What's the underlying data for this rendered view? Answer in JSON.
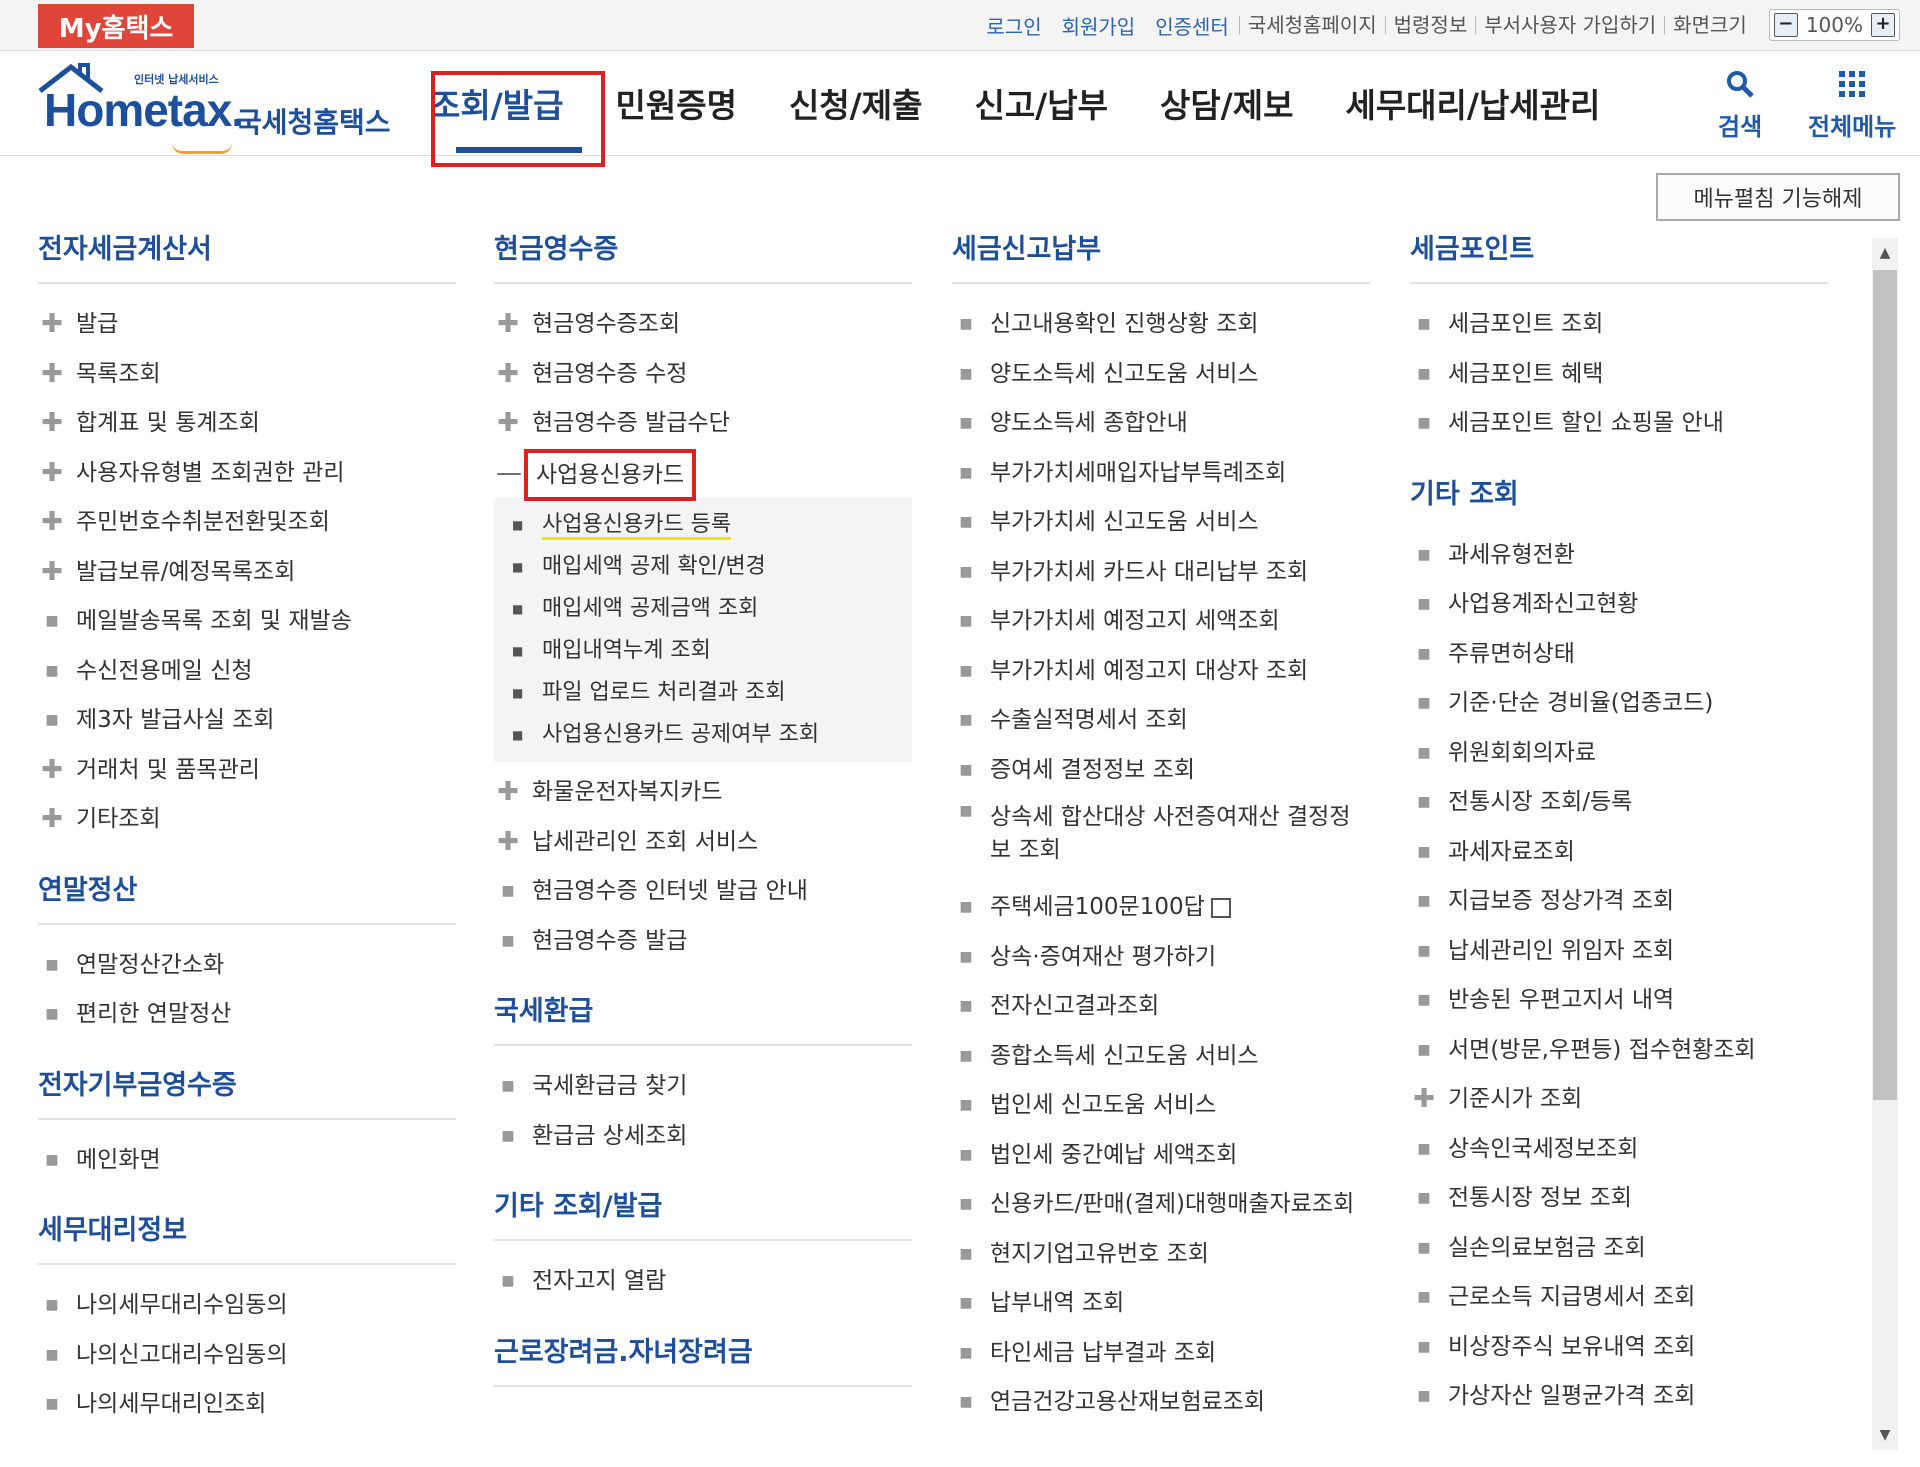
{
  "util_bar": {
    "my_tab": "My홈택스",
    "links_blue": [
      "로그인",
      "회원가입",
      "인증센터"
    ],
    "links_gray": [
      "국세청홈페이지",
      "법령정보",
      "부서사용자 가입하기",
      "화면크기"
    ],
    "zoom": "100%",
    "zoom_out": "−",
    "zoom_in": "+"
  },
  "header": {
    "logo_small": "인터넷 납세서비스",
    "logo_brand": "Hometax.",
    "logo_brand_ko": "국세청홈택스",
    "gnb": [
      "조회/발급",
      "민원증명",
      "신청/제출",
      "신고/납부",
      "상담/제보",
      "세무대리/납세관리"
    ],
    "search_label": "검색",
    "allmenu_label": "전체메뉴"
  },
  "menu_toggle": "메뉴펼침 기능해제",
  "col1": {
    "s1_title": "전자세금계산서",
    "s1_items": [
      "발급",
      "목록조회",
      "합계표 및 통계조회",
      "사용자유형별 조회권한 관리",
      "주민번호수취분전환및조회",
      "발급보류/예정목록조회",
      "메일발송목록 조회 및 재발송",
      "수신전용메일 신청",
      "제3자 발급사실 조회",
      "거래처 및 품목관리",
      "기타조회"
    ],
    "s2_title": "연말정산",
    "s2_items": [
      "연말정산간소화",
      "편리한 연말정산"
    ],
    "s3_title": "전자기부금영수증",
    "s3_items": [
      "메인화면"
    ],
    "s4_title": "세무대리정보",
    "s4_items": [
      "나의세무대리수임동의",
      "나의신고대리수임동의",
      "나의세무대리인조회"
    ]
  },
  "col2": {
    "s1_title": "현금영수증",
    "s1_items_top": [
      "현금영수증조회",
      "현금영수증 수정",
      "현금영수증 발급수단"
    ],
    "s1_open": "사업용신용카드",
    "s1_sub": [
      "사업용신용카드 등록",
      "매입세액 공제 확인/변경",
      "매입세액 공제금액 조회",
      "매입내역누계 조회",
      "파일 업로드 처리결과 조회",
      "사업용신용카드 공제여부 조회"
    ],
    "s1_items_bottom": [
      "화물운전자복지카드",
      "납세관리인 조회 서비스",
      "현금영수증 인터넷 발급 안내",
      "현금영수증 발급"
    ],
    "s2_title": "국세환급",
    "s2_items": [
      "국세환급금 찾기",
      "환급금 상세조회"
    ],
    "s3_title": "기타 조회/발급",
    "s3_items": [
      "전자고지 열람"
    ],
    "s4_title": "근로장려금.자녀장려금"
  },
  "col3": {
    "s1_title": "세금신고납부",
    "items_a": [
      "신고내용확인 진행상황 조회",
      "양도소득세 신고도움 서비스",
      "양도소득세 종합안내",
      "부가가치세매입자납부특례조회",
      "부가가치세 신고도움 서비스",
      "부가가치세 카드사 대리납부 조회",
      "부가가치세 예정고지 세액조회",
      "부가가치세 예정고지 대상자 조회",
      "수출실적명세서 조회",
      "증여세 결정정보 조회"
    ],
    "item_long": "상속세 합산대상 사전증여재산 결정정보 조회",
    "item_ext": "주택세금100문100답",
    "items_b": [
      "상속·증여재산 평가하기",
      "전자신고결과조회",
      "종합소득세 신고도움 서비스",
      "법인세 신고도움 서비스",
      "법인세 중간예납 세액조회",
      "신용카드/판매(결제)대행매출자료조회",
      "현지기업고유번호 조회",
      "납부내역 조회",
      "타인세금 납부결과 조회",
      "연금건강고용산재보험료조회"
    ]
  },
  "col4": {
    "s1_title": "세금포인트",
    "s1_items": [
      "세금포인트 조회",
      "세금포인트 혜택",
      "세금포인트 할인 쇼핑몰 안내"
    ],
    "s2_title": "기타 조회",
    "s2_items_a": [
      "과세유형전환",
      "사업용계좌신고현황",
      "주류면허상태",
      "기준·단순 경비율(업종코드)",
      "위원회회의자료",
      "전통시장 조회/등록",
      "과세자료조회",
      "지급보증 정상가격 조회",
      "납세관리인 위임자 조회",
      "반송된 우편고지서 내역",
      "서면(방문,우편등) 접수현황조회"
    ],
    "s2_plus_item": "기준시가 조회",
    "s2_items_b": [
      "상속인국세정보조회",
      "전통시장 정보 조회",
      "실손의료보험금 조회",
      "근로소득 지급명세서 조회",
      "비상장주식 보유내역 조회",
      "가상자산 일평균가격 조회"
    ]
  },
  "colors": {
    "accent": "#1e4f9b",
    "highlight_box": "#e02020",
    "underline": "#f4e500",
    "my_tab": "#e0453a"
  }
}
